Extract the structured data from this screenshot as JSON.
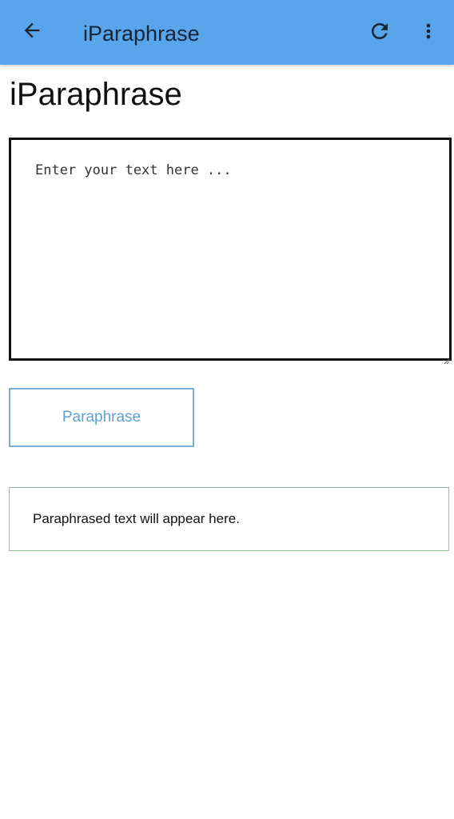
{
  "app_bar": {
    "title": "iParaphrase",
    "background": "#58a5ec",
    "icons": {
      "back": "arrow-back-icon",
      "refresh": "refresh-icon",
      "menu": "more-vert-icon"
    }
  },
  "main": {
    "title": "iParaphrase",
    "input": {
      "placeholder": "Enter your text here ...",
      "value": ""
    },
    "paraphrase_button": {
      "label": "Paraphrase",
      "color": "#5fa2d2"
    },
    "output": {
      "text": "Paraphrased text will appear here.",
      "border_color": "#8dc08d"
    }
  }
}
